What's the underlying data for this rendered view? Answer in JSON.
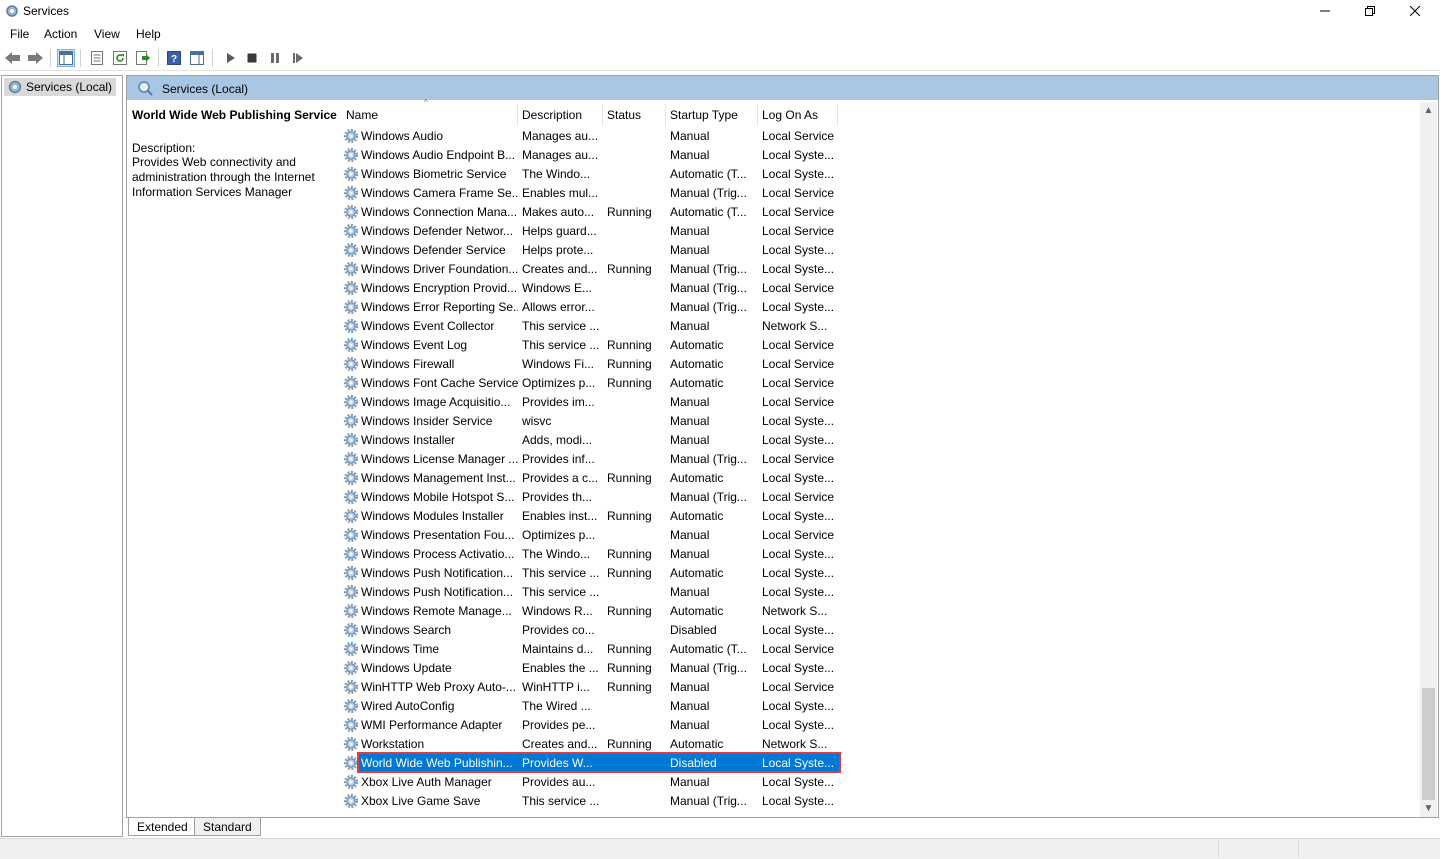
{
  "window": {
    "title": "Services"
  },
  "menubar": [
    "File",
    "Action",
    "View",
    "Help"
  ],
  "tree": {
    "root_label": "Services (Local)"
  },
  "main": {
    "header_title": "Services (Local)"
  },
  "details": {
    "service_name": "World Wide Web Publishing Service",
    "description_label": "Description:",
    "description_lines": [
      "Provides Web connectivity and",
      "administration through the Internet",
      "Information Services Manager"
    ]
  },
  "columns": [
    "Name",
    "Description",
    "Status",
    "Startup Type",
    "Log On As"
  ],
  "rows": [
    [
      "Windows Audio",
      "Manages au...",
      "",
      "Manual",
      "Local Service"
    ],
    [
      "Windows Audio Endpoint B...",
      "Manages au...",
      "",
      "Manual",
      "Local Syste..."
    ],
    [
      "Windows Biometric Service",
      "The Windo...",
      "",
      "Automatic (T...",
      "Local Syste..."
    ],
    [
      "Windows Camera Frame Se...",
      "Enables mul...",
      "",
      "Manual (Trig...",
      "Local Service"
    ],
    [
      "Windows Connection Mana...",
      "Makes auto...",
      "Running",
      "Automatic (T...",
      "Local Service"
    ],
    [
      "Windows Defender Networ...",
      "Helps guard...",
      "",
      "Manual",
      "Local Service"
    ],
    [
      "Windows Defender Service",
      "Helps prote...",
      "",
      "Manual",
      "Local Syste..."
    ],
    [
      "Windows Driver Foundation...",
      "Creates and...",
      "Running",
      "Manual (Trig...",
      "Local Syste..."
    ],
    [
      "Windows Encryption Provid...",
      "Windows E...",
      "",
      "Manual (Trig...",
      "Local Service"
    ],
    [
      "Windows Error Reporting Se...",
      "Allows error...",
      "",
      "Manual (Trig...",
      "Local Syste..."
    ],
    [
      "Windows Event Collector",
      "This service ...",
      "",
      "Manual",
      "Network S..."
    ],
    [
      "Windows Event Log",
      "This service ...",
      "Running",
      "Automatic",
      "Local Service"
    ],
    [
      "Windows Firewall",
      "Windows Fi...",
      "Running",
      "Automatic",
      "Local Service"
    ],
    [
      "Windows Font Cache Service",
      "Optimizes p...",
      "Running",
      "Automatic",
      "Local Service"
    ],
    [
      "Windows Image Acquisitio...",
      "Provides im...",
      "",
      "Manual",
      "Local Service"
    ],
    [
      "Windows Insider Service",
      "wisvc",
      "",
      "Manual",
      "Local Syste..."
    ],
    [
      "Windows Installer",
      "Adds, modi...",
      "",
      "Manual",
      "Local Syste..."
    ],
    [
      "Windows License Manager ...",
      "Provides inf...",
      "",
      "Manual (Trig...",
      "Local Service"
    ],
    [
      "Windows Management Inst...",
      "Provides a c...",
      "Running",
      "Automatic",
      "Local Syste..."
    ],
    [
      "Windows Mobile Hotspot S...",
      "Provides th...",
      "",
      "Manual (Trig...",
      "Local Service"
    ],
    [
      "Windows Modules Installer",
      "Enables inst...",
      "Running",
      "Automatic",
      "Local Syste..."
    ],
    [
      "Windows Presentation Fou...",
      "Optimizes p...",
      "",
      "Manual",
      "Local Service"
    ],
    [
      "Windows Process Activatio...",
      "The Windo...",
      "Running",
      "Manual",
      "Local Syste..."
    ],
    [
      "Windows Push Notification...",
      "This service ...",
      "Running",
      "Automatic",
      "Local Syste..."
    ],
    [
      "Windows Push Notification...",
      "This service ...",
      "",
      "Manual",
      "Local Syste..."
    ],
    [
      "Windows Remote Manage...",
      "Windows R...",
      "Running",
      "Automatic",
      "Network S..."
    ],
    [
      "Windows Search",
      "Provides co...",
      "",
      "Disabled",
      "Local Syste..."
    ],
    [
      "Windows Time",
      "Maintains d...",
      "Running",
      "Automatic (T...",
      "Local Service"
    ],
    [
      "Windows Update",
      "Enables the ...",
      "Running",
      "Manual (Trig...",
      "Local Syste..."
    ],
    [
      "WinHTTP Web Proxy Auto-...",
      "WinHTTP i...",
      "Running",
      "Manual",
      "Local Service"
    ],
    [
      "Wired AutoConfig",
      "The Wired ...",
      "",
      "Manual",
      "Local Syste..."
    ],
    [
      "WMI Performance Adapter",
      "Provides pe...",
      "",
      "Manual",
      "Local Syste..."
    ],
    [
      "Workstation",
      "Creates and...",
      "Running",
      "Automatic",
      "Network S..."
    ],
    [
      "World Wide Web Publishin...",
      "Provides W...",
      "",
      "Disabled",
      "Local Syste..."
    ],
    [
      "Xbox Live Auth Manager",
      "Provides au...",
      "",
      "Manual",
      "Local Syste..."
    ],
    [
      "Xbox Live Game Save",
      "This service ...",
      "",
      "Manual (Trig...",
      "Local Syste..."
    ]
  ],
  "selected_row": 33,
  "tabs": [
    "Extended",
    "Standard"
  ],
  "colors": {
    "selection": "#0078d7",
    "header_band": "#a9c6e3",
    "highlight_outline": "#e03c3c"
  }
}
